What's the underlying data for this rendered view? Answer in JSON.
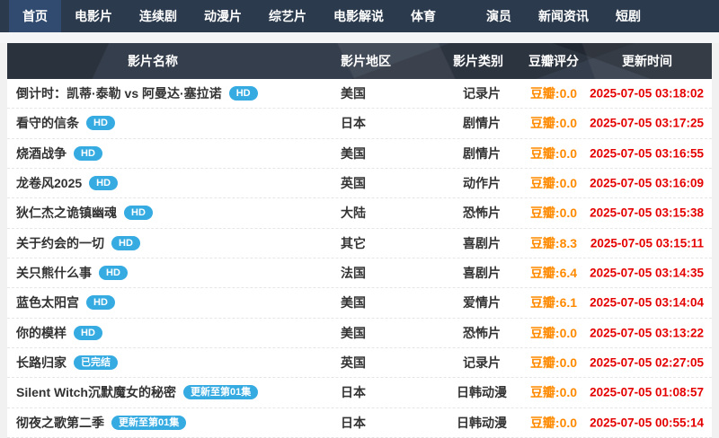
{
  "nav": {
    "items": [
      {
        "label": "首页",
        "active": true,
        "gap_before": false
      },
      {
        "label": "电影片",
        "active": false,
        "gap_before": false
      },
      {
        "label": "连续剧",
        "active": false,
        "gap_before": false
      },
      {
        "label": "动漫片",
        "active": false,
        "gap_before": false
      },
      {
        "label": "综艺片",
        "active": false,
        "gap_before": false
      },
      {
        "label": "电影解说",
        "active": false,
        "gap_before": false
      },
      {
        "label": "体育",
        "active": false,
        "gap_before": false
      },
      {
        "label": "演员",
        "active": false,
        "gap_before": true
      },
      {
        "label": "新闻资讯",
        "active": false,
        "gap_before": false
      },
      {
        "label": "短剧",
        "active": false,
        "gap_before": false
      }
    ]
  },
  "table": {
    "headers": {
      "name": "影片名称",
      "region": "影片地区",
      "type": "影片类别",
      "rating": "豆瓣评分",
      "time": "更新时间"
    },
    "rows": [
      {
        "name": "倒计时：凯蒂·泰勒 vs 阿曼达·塞拉诺",
        "badge": "HD",
        "region": "美国",
        "type": "记录片",
        "rating": "豆瓣:0.0",
        "time": "2025-07-05 03:18:02"
      },
      {
        "name": "看守的信条",
        "badge": "HD",
        "region": "日本",
        "type": "剧情片",
        "rating": "豆瓣:0.0",
        "time": "2025-07-05 03:17:25"
      },
      {
        "name": "烧酒战争",
        "badge": "HD",
        "region": "美国",
        "type": "剧情片",
        "rating": "豆瓣:0.0",
        "time": "2025-07-05 03:16:55"
      },
      {
        "name": "龙卷风2025",
        "badge": "HD",
        "region": "英国",
        "type": "动作片",
        "rating": "豆瓣:0.0",
        "time": "2025-07-05 03:16:09"
      },
      {
        "name": "狄仁杰之诡镇幽魂",
        "badge": "HD",
        "region": "大陆",
        "type": "恐怖片",
        "rating": "豆瓣:0.0",
        "time": "2025-07-05 03:15:38"
      },
      {
        "name": "关于约会的一切",
        "badge": "HD",
        "region": "其它",
        "type": "喜剧片",
        "rating": "豆瓣:8.3",
        "time": "2025-07-05 03:15:11"
      },
      {
        "name": "关只熊什么事",
        "badge": "HD",
        "region": "法国",
        "type": "喜剧片",
        "rating": "豆瓣:6.4",
        "time": "2025-07-05 03:14:35"
      },
      {
        "name": "蓝色太阳宫",
        "badge": "HD",
        "region": "美国",
        "type": "爱情片",
        "rating": "豆瓣:6.1",
        "time": "2025-07-05 03:14:04"
      },
      {
        "name": "你的模样",
        "badge": "HD",
        "region": "美国",
        "type": "恐怖片",
        "rating": "豆瓣:0.0",
        "time": "2025-07-05 03:13:22"
      },
      {
        "name": "长路归家",
        "badge": "已完结",
        "region": "英国",
        "type": "记录片",
        "rating": "豆瓣:0.0",
        "time": "2025-07-05 02:27:05"
      },
      {
        "name": "Silent Witch沉默魔女的秘密",
        "badge": "更新至第01集",
        "region": "日本",
        "type": "日韩动漫",
        "rating": "豆瓣:0.0",
        "time": "2025-07-05 01:08:57"
      },
      {
        "name": "彻夜之歌第二季",
        "badge": "更新至第01集",
        "region": "日本",
        "type": "日韩动漫",
        "rating": "豆瓣:0.0",
        "time": "2025-07-05 00:55:14"
      }
    ]
  },
  "colors": {
    "nav_background": "#2b3a4d",
    "nav_active_background": "#304a70",
    "header_background": "#353e4c",
    "badge_background": "#35abe2",
    "rating_orange": "#ff8a00",
    "time_red": "#e50000"
  }
}
